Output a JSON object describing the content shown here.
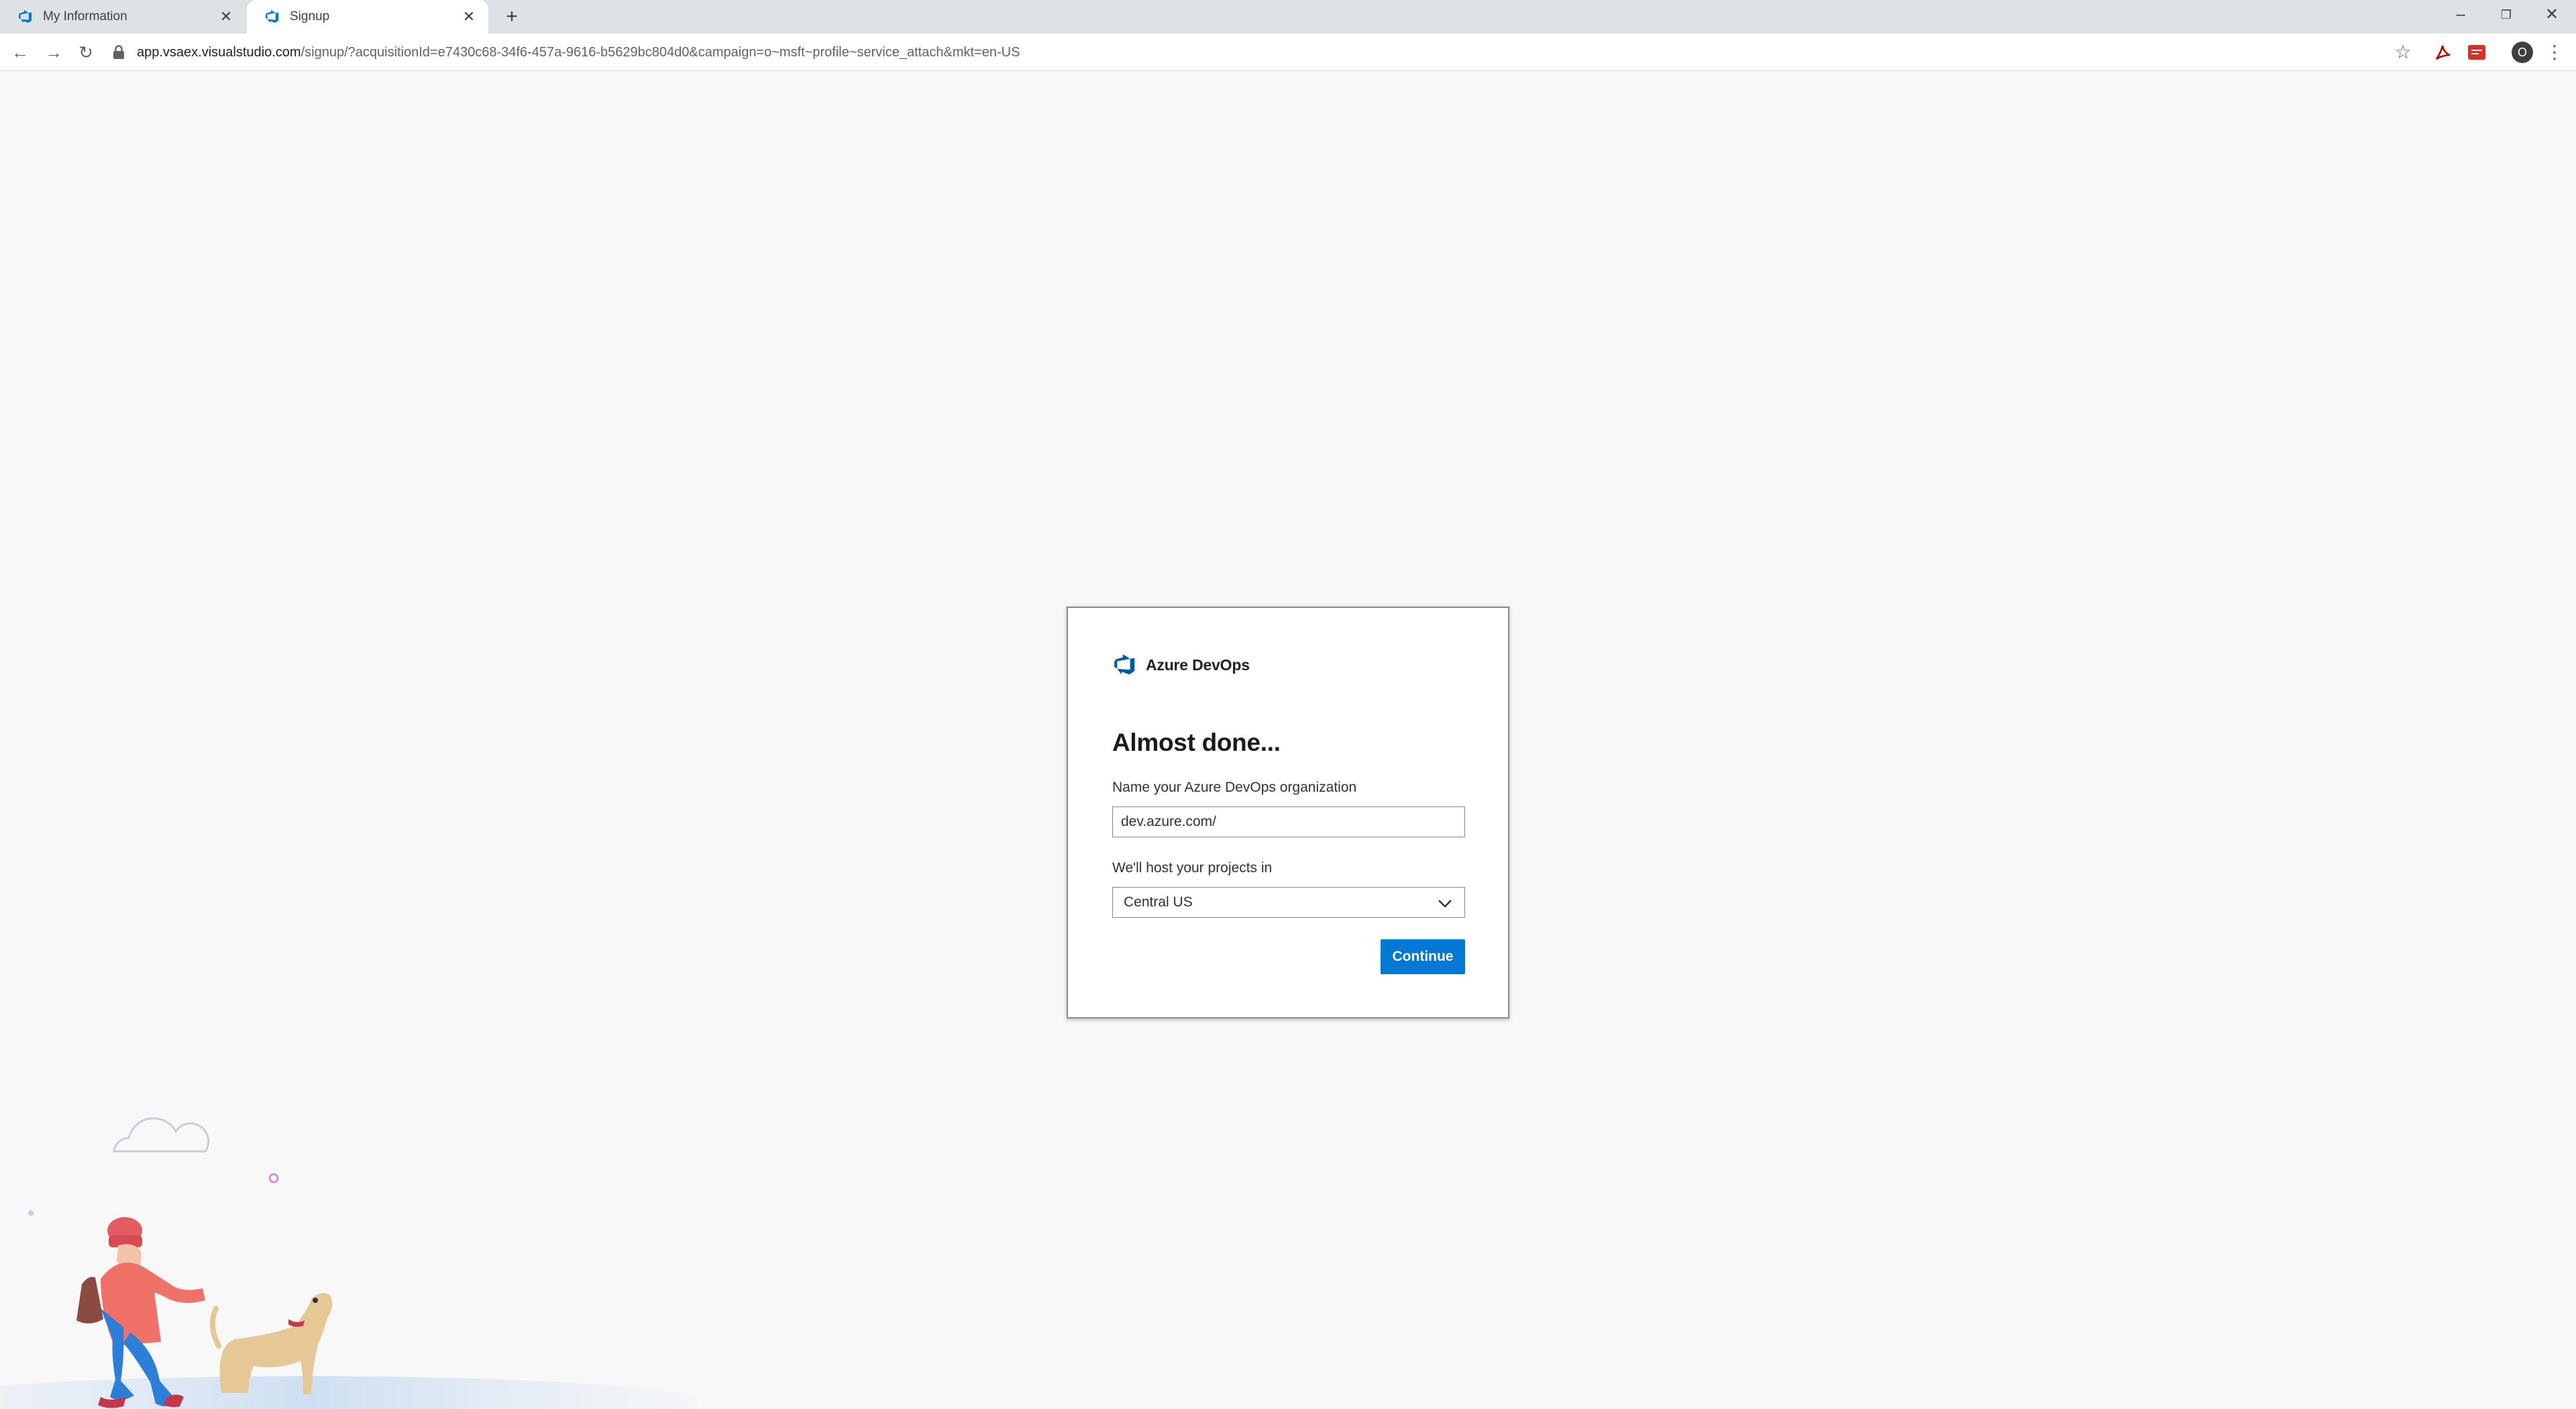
{
  "browser": {
    "tabs": [
      {
        "title": "My Information",
        "active": false,
        "icon": "azure-devops-icon"
      },
      {
        "title": "Signup",
        "active": true,
        "icon": "azure-devops-icon"
      }
    ],
    "new_tab_icon": "plus-icon",
    "url_host": "app.vsaex.visualstudio.com",
    "url_path": "/signup/?acquisitionId=e7430c68-34f6-457a-9616-b5629bc804d0&campaign=o~msft~profile~service_attach&mkt=en-US",
    "profile_initial": "O"
  },
  "signup": {
    "brand_name": "Azure DevOps",
    "heading": "Almost done...",
    "org_label": "Name your Azure DevOps organization",
    "org_value": "dev.azure.com/",
    "region_label": "We'll host your projects in",
    "region_value": "Central US",
    "continue_label": "Continue"
  },
  "colors": {
    "accent": "#0078d4",
    "brand_icon": "#005ba1",
    "page_bg": "#f8f8f8"
  }
}
